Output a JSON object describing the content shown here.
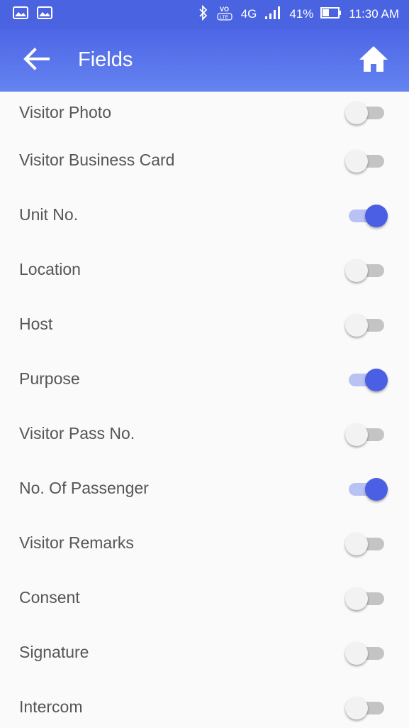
{
  "status_bar": {
    "battery_percent": "41%",
    "time": "11:30 AM",
    "network": "4G",
    "volte": "VoLTE"
  },
  "header": {
    "title": "Fields"
  },
  "fields": [
    {
      "label": "Visitor Photo",
      "enabled": false
    },
    {
      "label": "Visitor Business Card",
      "enabled": false
    },
    {
      "label": "Unit No.",
      "enabled": true
    },
    {
      "label": "Location",
      "enabled": false
    },
    {
      "label": "Host",
      "enabled": false
    },
    {
      "label": "Purpose",
      "enabled": true
    },
    {
      "label": "Visitor Pass No.",
      "enabled": false
    },
    {
      "label": "No. Of Passenger",
      "enabled": true
    },
    {
      "label": "Visitor Remarks",
      "enabled": false
    },
    {
      "label": "Consent",
      "enabled": false
    },
    {
      "label": "Signature",
      "enabled": false
    },
    {
      "label": "Intercom",
      "enabled": false
    }
  ],
  "colors": {
    "primary": "#4a63e0",
    "switch_on_knob": "#4a5fe3",
    "switch_on_track": "#b8c2f3",
    "switch_off_track": "#c4c4c4"
  }
}
